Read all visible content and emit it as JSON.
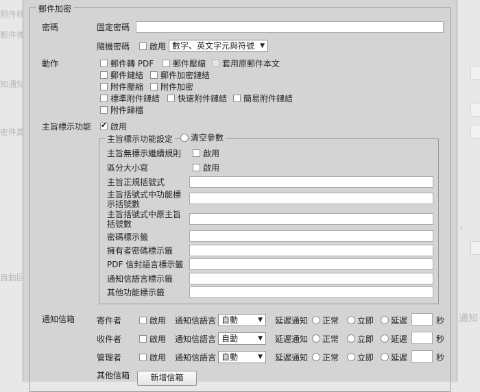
{
  "background": {
    "labels": [
      "附件移",
      "郵件後",
      "知通知",
      "密件篇",
      "自動回"
    ],
    "right_text": "通知"
  },
  "fieldset": {
    "legend": "郵件加密"
  },
  "password": {
    "label": "密碼",
    "fixed_label": "固定密碼",
    "fixed_value": "",
    "random_label": "隨機密碼",
    "random_enable": "啟用",
    "random_select": "數字、英文字元與符號"
  },
  "action": {
    "label": "動作",
    "options": [
      "郵件轉 PDF",
      "郵件壓縮",
      "套用原郵件本文",
      "郵件鏈結",
      "郵件加密鏈結",
      "附件壓縮",
      "附件加密",
      "標準附件鏈結",
      "快速附件鏈結",
      "簡易附件鏈結",
      "附件歸檔"
    ]
  },
  "subject": {
    "label": "主旨標示功能",
    "enable": "啟用",
    "setup_legend": "主旨標示功能設定",
    "clear_params": "清空參數",
    "rows": [
      {
        "label": "主旨無標示繼續規則",
        "kind": "checkbox",
        "text": "啟用"
      },
      {
        "label": "區分大小寫",
        "kind": "checkbox",
        "text": "啟用"
      },
      {
        "label": "主旨正規括號式",
        "kind": "input",
        "value": ""
      },
      {
        "label": "主旨括號式中功能標示括號數",
        "kind": "input",
        "value": ""
      },
      {
        "label": "主旨括號式中原主旨括號數",
        "kind": "input",
        "value": ""
      },
      {
        "label": "密碼標示籤",
        "kind": "input",
        "value": ""
      },
      {
        "label": "擁有者密碼標示籤",
        "kind": "input",
        "value": ""
      },
      {
        "label": "PDF 信封語言標示籤",
        "kind": "input",
        "value": ""
      },
      {
        "label": "通知信語言標示籤",
        "kind": "input",
        "value": ""
      },
      {
        "label": "其他功能標示籤",
        "kind": "input",
        "value": ""
      }
    ]
  },
  "notify": {
    "label": "通知信箱",
    "rows": [
      {
        "role": "寄件者",
        "enable": "啟用",
        "lang_label": "通知信語言",
        "lang_value": "自動",
        "delay_label": "延遲通知",
        "opt_normal": "正常",
        "opt_now": "立即",
        "opt_delay": "延遲",
        "unit": "秒"
      },
      {
        "role": "收件者",
        "enable": "啟用",
        "lang_label": "通知信語言",
        "lang_value": "自動",
        "delay_label": "延遲通知",
        "opt_normal": "正常",
        "opt_now": "立即",
        "opt_delay": "延遲",
        "unit": "秒"
      },
      {
        "role": "管理者",
        "enable": "啟用",
        "lang_label": "通知信語言",
        "lang_value": "自動",
        "delay_label": "延遲通知",
        "opt_normal": "正常",
        "opt_now": "立即",
        "opt_delay": "延遲",
        "unit": "秒"
      }
    ],
    "other_label": "其他信箱",
    "add_button": "新增信箱"
  }
}
